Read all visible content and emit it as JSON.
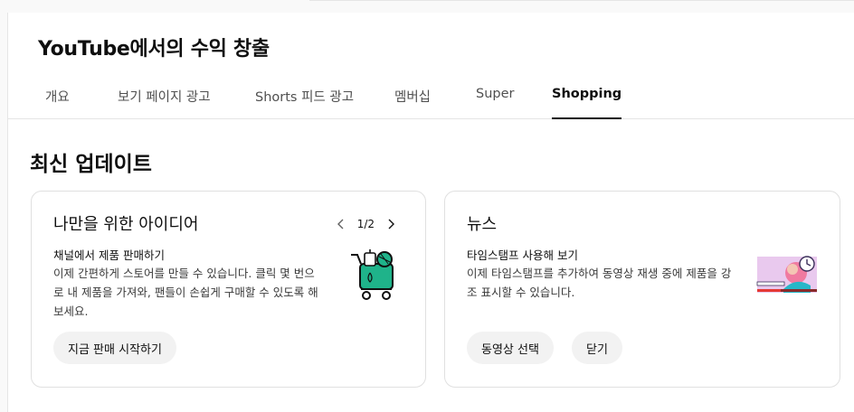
{
  "page": {
    "title": "YouTube에서의 수익 창출"
  },
  "tabs": [
    {
      "label": "개요",
      "active": false
    },
    {
      "label": "보기 페이지 광고",
      "active": false
    },
    {
      "label": "Shorts 피드 광고",
      "active": false
    },
    {
      "label": "멤버십",
      "active": false
    },
    {
      "label": "Super",
      "active": false
    },
    {
      "label": "Shopping",
      "active": true
    }
  ],
  "updates": {
    "section_title": "최신 업데이트",
    "ideas_card": {
      "title": "나만을 위한 아이디어",
      "pager": "1/2",
      "subtitle": "채널에서 제품 판매하기",
      "body": "이제 간편하게 스토어를 만들 수 있습니다. 클릭 몇 번으로 내 제품을 가져와, 팬들이 손쉽게 구매할 수 있도록 해보세요.",
      "button": "지금 판매 시작하기",
      "illustration_icon": "shopping-cart-icon"
    },
    "news_card": {
      "title": "뉴스",
      "subtitle": "타임스탬프 사용해 보기",
      "body": "이제 타임스탬프를 추가하여 동영상 재생 중에 제품을 강조 표시할 수 있습니다.",
      "primary_button": "동영상 선택",
      "secondary_button": "닫기",
      "illustration_icon": "video-timestamp-icon"
    }
  },
  "colors": {
    "accent_green": "#1fb38a",
    "text_primary": "#0f0f0f",
    "button_bg": "#f2f2f2"
  }
}
